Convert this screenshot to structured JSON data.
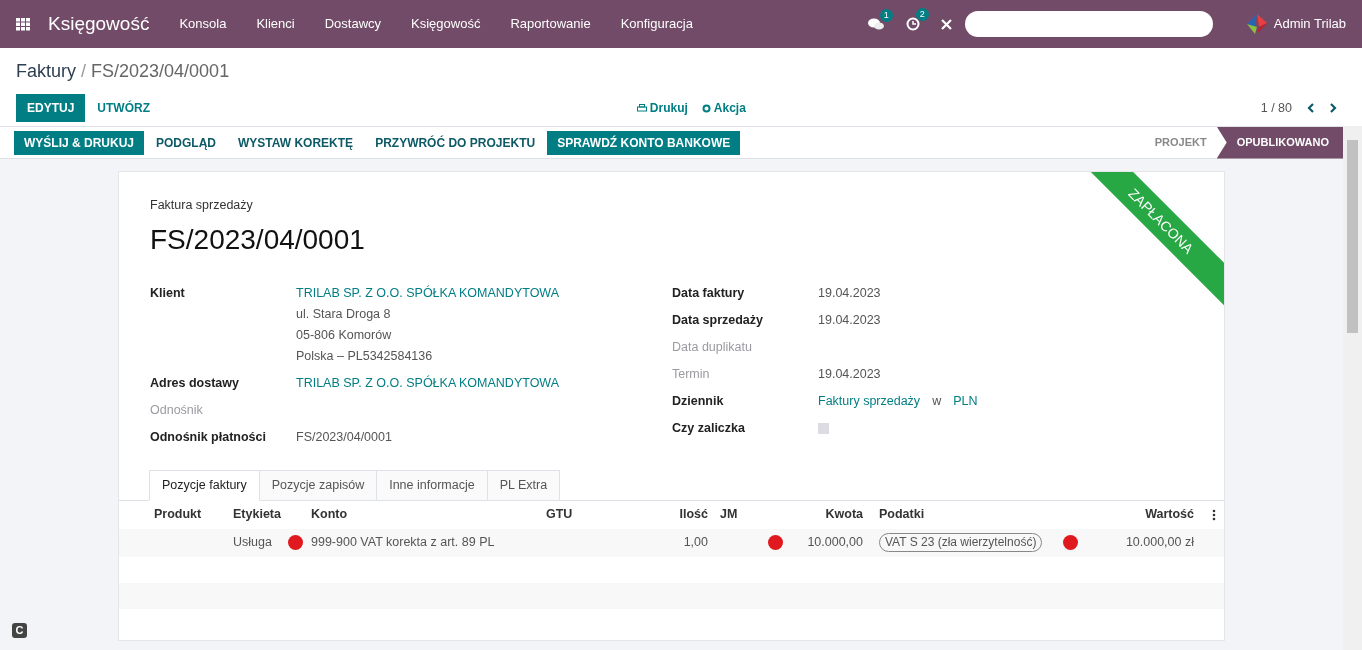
{
  "navbar": {
    "app_title": "Księgowość",
    "menu": [
      "Konsola",
      "Klienci",
      "Dostawcy",
      "Księgowość",
      "Raportowanie",
      "Konfiguracja"
    ],
    "messages_count": "1",
    "activities_count": "2",
    "user": "Admin Trilab"
  },
  "breadcrumb": {
    "parent": "Faktury",
    "separator": "/",
    "current": "FS/2023/04/0001"
  },
  "control_panel": {
    "edit": "EDYTUJ",
    "create": "UTWÓRZ",
    "print": "Drukuj",
    "action": "Akcja",
    "pager": "1 / 80"
  },
  "header_actions": [
    {
      "label": "WYŚLIJ & DRUKUJ",
      "kind": "primary"
    },
    {
      "label": "PODGLĄD",
      "kind": "secondary"
    },
    {
      "label": "WYSTAW KOREKTĘ",
      "kind": "secondary"
    },
    {
      "label": "PRZYWRÓĆ DO PROJEKTU",
      "kind": "secondary"
    },
    {
      "label": "SPRAWDŹ KONTO BANKOWE",
      "kind": "primary"
    }
  ],
  "status_stages": [
    {
      "label": "PROJEKT",
      "selected": false
    },
    {
      "label": "OPUBLIKOWANO",
      "selected": true
    }
  ],
  "sheet": {
    "ribbon": "ZAPŁACONA",
    "document_type": "Faktura sprzedaży",
    "number": "FS/2023/04/0001",
    "left_fields": [
      {
        "label": "Klient",
        "muted": false,
        "kind": "text",
        "lines": [
          [
            {
              "text": "TRILAB SP. Z O.O. SPÓŁKA KOMANDYTOWA",
              "link": true
            }
          ],
          [
            {
              "text": "ul. Stara Droga 8",
              "link": false
            }
          ],
          [
            {
              "text": "05-806 Komorów",
              "link": false
            }
          ],
          [
            {
              "text": "Polska – PL5342584136",
              "link": false
            }
          ]
        ]
      },
      {
        "label": "Adres dostawy",
        "muted": false,
        "kind": "text",
        "lines": [
          [
            {
              "text": "TRILAB SP. Z O.O. SPÓŁKA KOMANDYTOWA",
              "link": true
            }
          ]
        ]
      },
      {
        "label": "Odnośnik",
        "muted": true,
        "kind": "text"
      },
      {
        "label": "Odnośnik płatności",
        "muted": false,
        "kind": "text",
        "lines": [
          [
            {
              "text": "FS/2023/04/0001",
              "link": false
            }
          ]
        ]
      }
    ],
    "right_fields": [
      {
        "label": "Data faktury",
        "muted": false,
        "kind": "text",
        "lines": [
          [
            {
              "text": "19.04.2023",
              "link": false
            }
          ]
        ]
      },
      {
        "label": "Data sprzedaży",
        "muted": false,
        "kind": "text",
        "lines": [
          [
            {
              "text": "19.04.2023",
              "link": false
            }
          ]
        ]
      },
      {
        "label": "Data duplikatu",
        "muted": true,
        "kind": "text"
      },
      {
        "label": "Termin",
        "muted": true,
        "kind": "text",
        "lines": [
          [
            {
              "text": "19.04.2023",
              "link": false
            }
          ]
        ]
      },
      {
        "label": "Dziennik",
        "muted": false,
        "kind": "text",
        "lines": [
          [
            {
              "text": "Faktury sprzedaży",
              "link": true
            },
            {
              "text": "w",
              "link": false
            },
            {
              "text": "PLN",
              "link": true
            }
          ]
        ]
      },
      {
        "label": "Czy zaliczka",
        "muted": false,
        "kind": "checkbox",
        "checked": false
      }
    ],
    "tabs": [
      {
        "label": "Pozycje faktury",
        "selected": true
      },
      {
        "label": "Pozycje zapisów",
        "selected": false
      },
      {
        "label": "Inne informacje",
        "selected": false
      },
      {
        "label": "PL Extra",
        "selected": false
      }
    ],
    "table": {
      "columns": [
        "Produkt",
        "Etykieta",
        "Konto",
        "GTU",
        "Ilość",
        "JM",
        "Kwota",
        "Podatki",
        "Wartość"
      ],
      "rows": [
        {
          "label": "Usługa",
          "account": "999-900 VAT korekta z art. 89 PL",
          "account_warning": true,
          "quantity": "1,00",
          "amount": "10.000,00",
          "amount_warning": true,
          "taxes": [
            "VAT S 23 (zła wierzytelność)"
          ],
          "tax_warning": true,
          "subtotal": "10.000,00 zł"
        }
      ]
    }
  },
  "corner_badge": "C"
}
